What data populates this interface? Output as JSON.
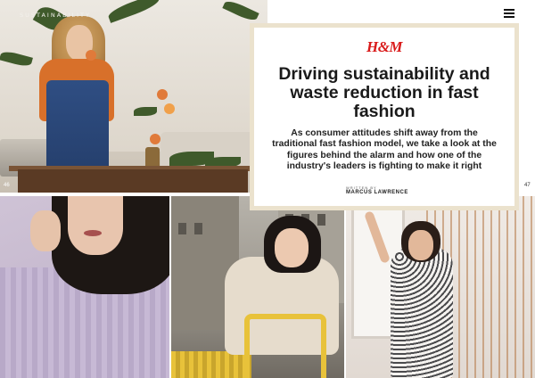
{
  "header": {
    "section_label": "SUSTAINABILITY",
    "menu_icon": "hamburger-menu-icon"
  },
  "page_numbers": {
    "left": "46",
    "right": "47"
  },
  "article": {
    "brand": "H&M",
    "headline": "Driving sustainability and waste reduction in fast fashion",
    "dek": "As consumer attitudes shift away from the traditional fast fashion model, we take a look at the figures behind the alarm and how one of the industry's leaders is fighting to make it right",
    "byline_label": "WRITTEN BY",
    "author": "MARCUS LAWRENCE"
  },
  "colors": {
    "brand_red": "#d91a1a",
    "card_border": "#ebe2cd"
  }
}
